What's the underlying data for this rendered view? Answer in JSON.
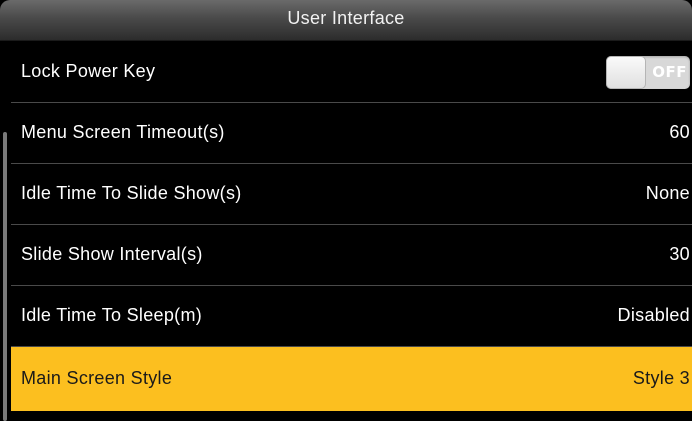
{
  "window": {
    "title": "User Interface"
  },
  "menu": {
    "items": [
      {
        "label": "Lock Power Key",
        "value": "OFF",
        "type": "toggle"
      },
      {
        "label": "Menu Screen Timeout(s)",
        "value": "60",
        "type": "value"
      },
      {
        "label": "Idle Time To Slide Show(s)",
        "value": "None",
        "type": "value"
      },
      {
        "label": "Slide Show Interval(s)",
        "value": "30",
        "type": "value"
      },
      {
        "label": "Idle Time To Sleep(m)",
        "value": "Disabled",
        "type": "value"
      },
      {
        "label": "Main Screen Style",
        "value": "Style 3",
        "type": "value",
        "selected": true
      }
    ]
  },
  "colors": {
    "background": "#000000",
    "selected_row": "#fcbf1f",
    "divider": "#4a4a4a",
    "text": "#ffffff",
    "toggle_off": "#d8d8d8"
  },
  "icons": {
    "toggle": "toggle-switch-off"
  }
}
